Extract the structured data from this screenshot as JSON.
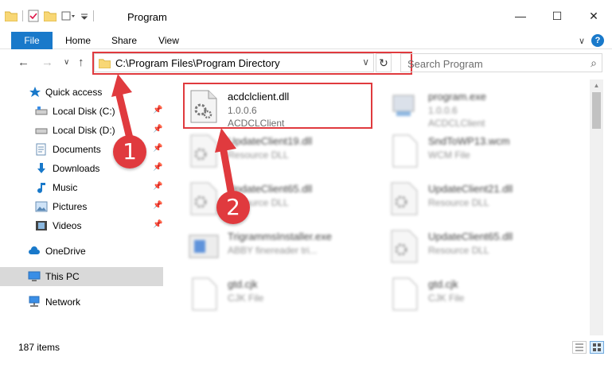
{
  "window": {
    "title": "Program",
    "minimize_glyph": "—",
    "maximize_glyph": "☐",
    "close_glyph": "✕"
  },
  "ribbon": {
    "tabs": [
      {
        "label": "File"
      },
      {
        "label": "Home"
      },
      {
        "label": "Share"
      },
      {
        "label": "View"
      }
    ],
    "help_glyph": "?",
    "expand_glyph": "∨"
  },
  "navigation": {
    "back_glyph": "←",
    "forward_glyph": "→",
    "recent_glyph": "∨",
    "up_glyph": "↑",
    "address": "C:\\Program Files\\Program Directory",
    "address_dropdown_glyph": "∨",
    "refresh_glyph": "↻",
    "search_placeholder": "Search Program",
    "search_glyph": "⌕"
  },
  "sidebar": {
    "items": [
      {
        "label": "Quick access",
        "icon": "star-icon"
      },
      {
        "label": "Local Disk (C:)",
        "icon": "drive-icon",
        "pinned": true
      },
      {
        "label": "Local Disk (D:)",
        "icon": "drive-icon",
        "pinned": true
      },
      {
        "label": "Documents",
        "icon": "documents-icon",
        "pinned": true
      },
      {
        "label": "Downloads",
        "icon": "download-icon",
        "pinned": true
      },
      {
        "label": "Music",
        "icon": "music-icon",
        "pinned": true
      },
      {
        "label": "Pictures",
        "icon": "pictures-icon",
        "pinned": true
      },
      {
        "label": "Videos",
        "icon": "videos-icon",
        "pinned": true
      },
      {
        "label": "OneDrive",
        "icon": "cloud-icon"
      },
      {
        "label": "This PC",
        "icon": "computer-icon",
        "selected": true
      },
      {
        "label": "Network",
        "icon": "network-icon"
      }
    ],
    "pin_glyph": "📌"
  },
  "files": [
    {
      "name": "acdclclient.dll",
      "line2": "1.0.0.6",
      "line3": "ACDCLClient",
      "highlighted": true
    },
    {
      "name": "program.exe",
      "line2": "1.0.0.6",
      "line3": "ACDCLClient"
    },
    {
      "name": "UpdateClient19.dll",
      "line2": "Resource DLL"
    },
    {
      "name": "SndToWP13.wcm",
      "line2": "WCM File"
    },
    {
      "name": "UpdateClient65.dll",
      "line2": "Resource DLL"
    },
    {
      "name": "UpdateClient21.dll",
      "line2": "Resource DLL"
    },
    {
      "name": "TrigrammsInstaller.exe",
      "line2": "ABBY finereader tri..."
    },
    {
      "name": "UpdateClient65.dll",
      "line2": "Resource DLL"
    },
    {
      "name": "gtd.cjk",
      "line2": "CJK File"
    },
    {
      "name": "gtd.cjk",
      "line2": "CJK File"
    }
  ],
  "status": {
    "item_count": "187 items"
  },
  "callouts": [
    {
      "label": "1"
    },
    {
      "label": "2"
    }
  ],
  "colors": {
    "accent": "#1979ca",
    "highlight_red": "#e03a3e",
    "selected_bg": "#d9d9d9"
  }
}
